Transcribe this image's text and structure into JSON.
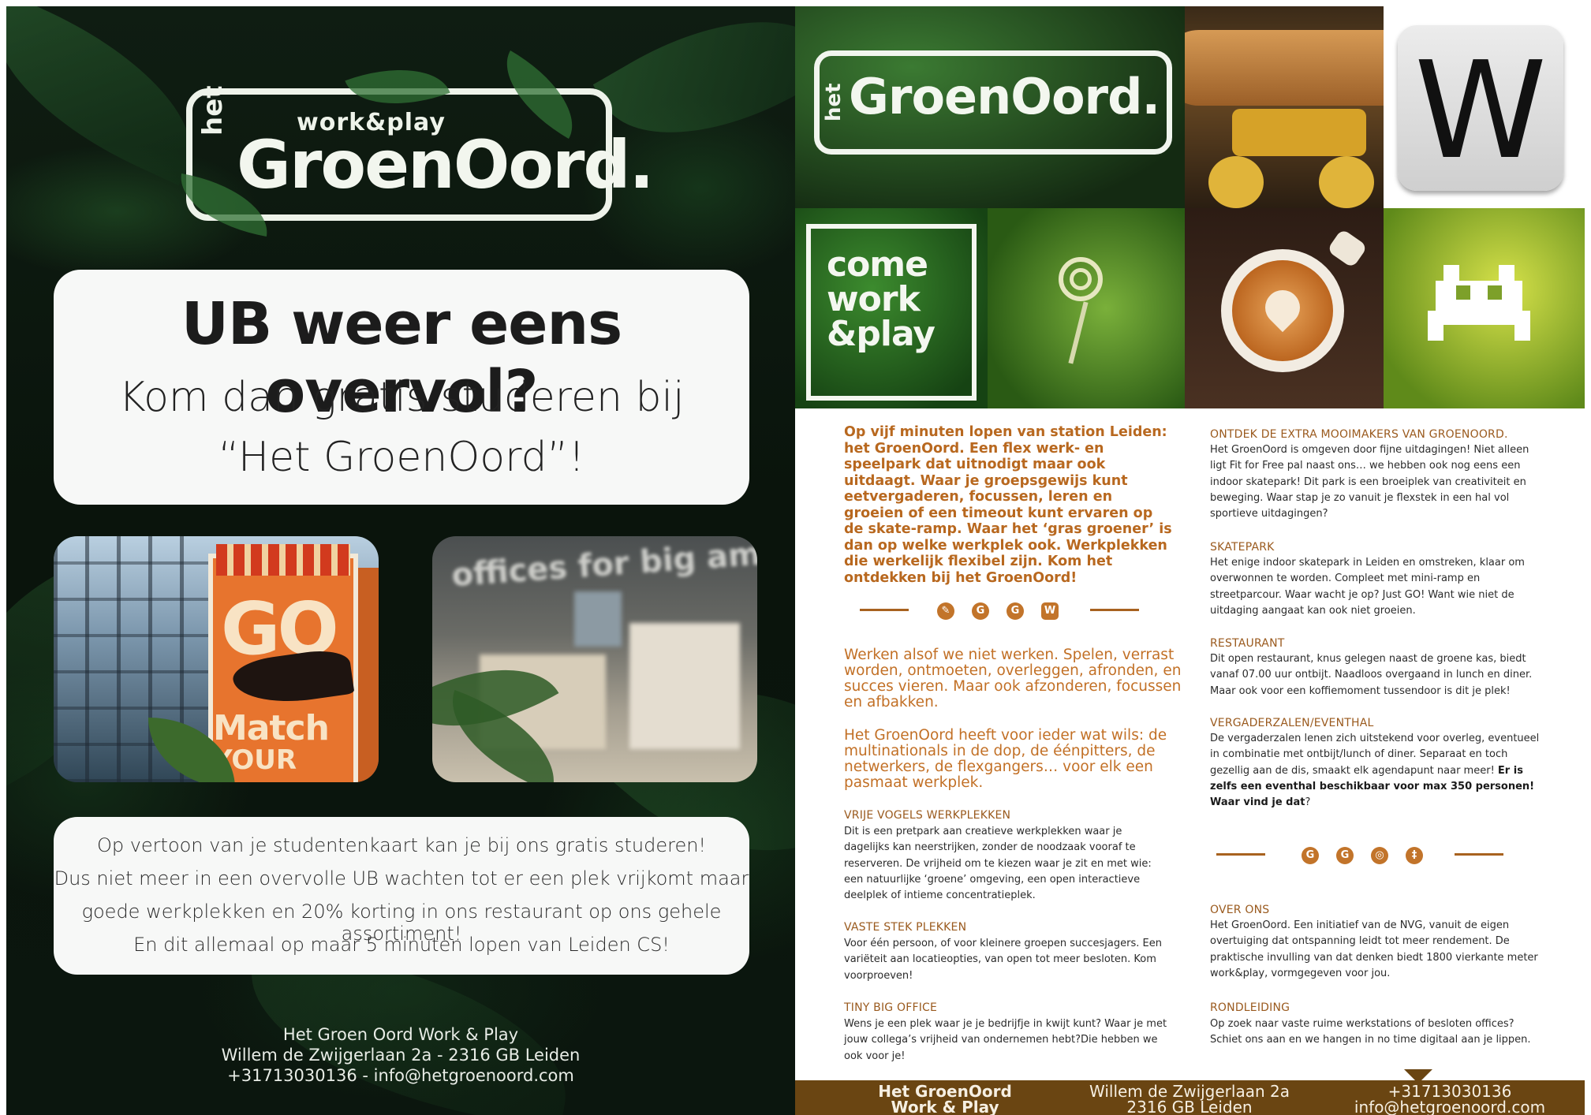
{
  "left_poster": {
    "logo": {
      "het": "het",
      "tagline": "work&play",
      "name": "GroenOord."
    },
    "headline": "UB weer eens overvol?",
    "subheadline_1": "Kom dan gratis studeren bij",
    "subheadline_2": "“Het GroenOord”!",
    "photo_go": {
      "go": "GO",
      "match": "Match",
      "dreams": "YOUR Dreams"
    },
    "photo_office": {
      "sign": "offices for big ambitions"
    },
    "info_lines": [
      "Op vertoon van je studentenkaart kan je bij ons gratis studeren!",
      "Dus niet meer in een overvolle UB wachten tot er een plek vrijkomt maar",
      "goede werkplekken en 20% korting in ons restaurant op ons gehele assortiment!",
      "En dit allemaal op maar 5 minuten lopen van Leiden CS!"
    ],
    "contact": {
      "name": "Het Groen Oord Work & Play",
      "address": "Willem de Zwijgerlaan 2a  -  2316 GB Leiden",
      "phone_email": "+31713030136  -  info@hetgroenoord.com"
    }
  },
  "right_brochure": {
    "logo": {
      "het": "het",
      "name": "GroenOord."
    },
    "w_letter": "W",
    "come_work_play": "come work &play",
    "intro": "Op vijf minuten lopen van station Leiden: het GroenOord. Een flex werk- en speelpark dat uitnodigt maar ook uitdaagt. Waar je groepsgewijs kunt eetvergaderen, focussen, leren en groeien of een timeout kunt ervaren op de skate-ramp. Waar het ‘gras groener’ is dan op welke werkplek ook. Werkplekken die werkelijk flexibel zijn. Kom het ontdekken bij het GroenOord!",
    "mid_1": "Werken alsof we niet werken. Spelen, verrast worden, ontmoeten, overleggen, afronden, en succes vieren. Maar ook afzonderen, focussen en afbakken.",
    "mid_2": "Het GroenOord heeft voor ieder wat wils: de multinationals in de dop, de éénpitters, de netwerkers, de flexgangers… voor elk een pasmaat werkplek.",
    "left_sections": [
      {
        "heading": "VRIJE VOGELS WERKPLEKKEN",
        "body": "Dit is een pretpark aan creatieve werkplekken waar je dagelijks kan neerstrijken, zonder de noodzaak vooraf te reserveren. De vrijheid om te kiezen waar je zit en met wie: een natuurlijke ‘groene’ omgeving, een open interactieve deelplek of intieme concentratieplek."
      },
      {
        "heading": "VASTE STEK PLEKKEN",
        "body": "Voor één persoon, of voor kleinere groepen succesjagers. Een variëteit aan locatieopties, van open tot meer besloten. Kom voorproeven!"
      },
      {
        "heading": "TINY BIG OFFICE",
        "body": "Wens je een plek waar je je bedrijfje in kwijt kunt? Waar je met jouw collega’s vrijheid van ondernemen hebt?Die hebben we ook voor je!"
      }
    ],
    "right_sections": [
      {
        "heading": "ONTDEK DE EXTRA MOOIMAKERS VAN GROENOORD.",
        "body": "Het GroenOord is omgeven door fijne uitdagingen! Niet alleen ligt Fit for Free pal naast ons… we hebben ook nog eens een indoor skatepark! Dit park is een broeiplek van creativiteit en beweging. Waar stap je zo vanuit je flexstek in een hal vol sportieve uitdagingen?"
      },
      {
        "heading": "SKATEPARK",
        "body": "Het enige indoor skatepark in Leiden en omstreken, klaar om overwonnen te worden. Compleet met mini-ramp en streetparcour. Waar wacht je op? Just GO! Want wie niet de uitdaging aangaat kan ook niet groeien."
      },
      {
        "heading": "RESTAURANT",
        "body": "Dit open restaurant, knus gelegen naast de groene kas, biedt vanaf 07.00 uur ontbijt. Naadloos overgaand in lunch en diner. Maar ook voor een koffiemoment tussendoor is dit je plek!"
      },
      {
        "heading": "VERGADERZALEN/EVENTHAL",
        "body": "De vergaderzalen lenen zich uitstekend voor overleg, eventueel in combinatie met ontbijt/lunch of diner. Separaat en toch gezellig aan de dis, smaakt elk agendapunt naar meer!",
        "bold": "Er is zelfs een eventhal beschikbaar voor max 350 personen! Waar vind je dat",
        "tail": "?"
      },
      {
        "heading": "OVER ONS",
        "body": "Het GroenOord. Een initiatief van de NVG, vanuit de eigen overtuiging dat ontspanning leidt tot meer rendement. De praktische invulling van dat denken biedt 1800 vierkante meter work&play, vormgegeven voor jou."
      },
      {
        "heading": "RONDLEIDING",
        "body": "Op zoek naar vaste ruime werkstations of besloten offices? Schiet ons aan en we hangen in no time digitaal aan je lippen."
      }
    ],
    "icons_top": [
      "skateboard-icon",
      "g-icon",
      "o-icon",
      "w-icon"
    ],
    "icons_bottom": [
      "g-icon",
      "o-icon",
      "mask-icon",
      "tree-icon"
    ],
    "footer": {
      "name_1": "Het GroenOord",
      "name_2": "Work & Play",
      "addr_1": "Willem de Zwijgerlaan 2a",
      "addr_2": "2316 GB Leiden",
      "phone": "+31713030136",
      "email": "info@hetgroenoord.com"
    }
  },
  "colors": {
    "accent_orange": "#c27026",
    "footer_brown": "#6a4512",
    "dark_green": "#0f1d12"
  }
}
